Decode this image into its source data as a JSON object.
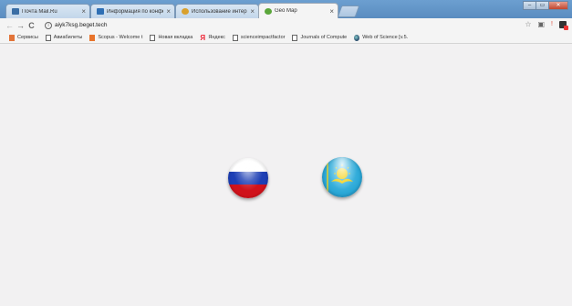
{
  "tabs": [
    {
      "label": "Почта Mail.Ru",
      "favicon_color": "#3a6ea5",
      "active": false
    },
    {
      "label": "Информация по конфе",
      "favicon_color": "#2f6fb4",
      "active": false
    },
    {
      "label": "Использование интер",
      "favicon_color": "#d9a02c",
      "active": false
    },
    {
      "label": "Geo Map",
      "favicon_color": "#5aa63a",
      "active": true
    }
  ],
  "window_controls": {
    "minimize": "–",
    "maximize": "▭",
    "close": "✕"
  },
  "toolbar": {
    "back": "←",
    "forward": "→",
    "reload": "C",
    "url": "aiyk7ksg.beget.tech"
  },
  "bookmarks": [
    {
      "label": "Сервисы",
      "icon": "apps-icon"
    },
    {
      "label": "Авиабилеты",
      "icon": "page-icon"
    },
    {
      "label": "Scopus - Welcome t",
      "icon": "scopus-icon"
    },
    {
      "label": "Новая вкладка",
      "icon": "page-icon"
    },
    {
      "label": "Яндекс",
      "icon": "yandex-icon"
    },
    {
      "label": "scienceimpactfactor",
      "icon": "page-icon"
    },
    {
      "label": "Journals of Compute",
      "icon": "page-icon"
    },
    {
      "label": "Web of Science [v.5.",
      "icon": "web-of-science-icon"
    }
  ],
  "flags": [
    {
      "country": "russia",
      "colors": [
        "#ffffff",
        "#1d3fb5",
        "#d0121b"
      ]
    },
    {
      "country": "kazakhstan",
      "colors": [
        "#2aa7d6",
        "#f4d21a"
      ]
    }
  ]
}
